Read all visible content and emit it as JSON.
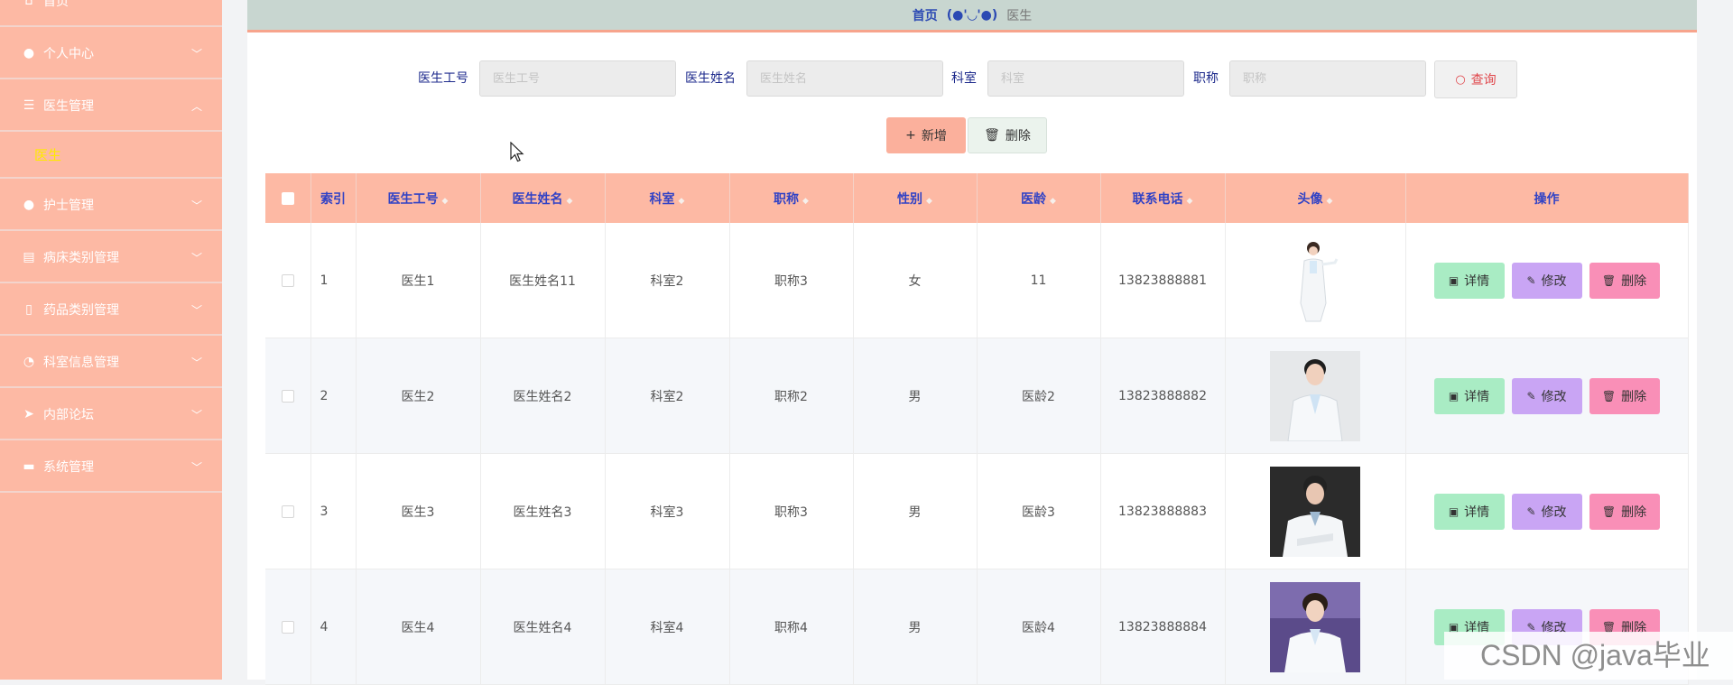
{
  "sidebar": {
    "items": [
      {
        "label": "首页",
        "icon": "home-icon",
        "caret": ""
      },
      {
        "label": "个人中心",
        "icon": "user-icon",
        "caret": "﹀"
      },
      {
        "label": "医生管理",
        "icon": "list-icon",
        "caret": "︿"
      },
      {
        "label": "护士管理",
        "icon": "user-icon",
        "caret": "﹀"
      },
      {
        "label": "病床类别管理",
        "icon": "chat-icon",
        "caret": "﹀"
      },
      {
        "label": "药品类别管理",
        "icon": "mic-icon",
        "caret": "﹀"
      },
      {
        "label": "科室信息管理",
        "icon": "gauge-icon",
        "caret": "﹀"
      },
      {
        "label": "内部论坛",
        "icon": "send-icon",
        "caret": "﹀"
      },
      {
        "label": "系统管理",
        "icon": "briefcase-icon",
        "caret": "﹀"
      }
    ],
    "active_submenu": "医生"
  },
  "breadcrumb": {
    "home": "首页",
    "face": "(●'◡'●)",
    "current": "医生"
  },
  "search": {
    "fields": [
      {
        "label": "医生工号",
        "placeholder": "医生工号",
        "value": ""
      },
      {
        "label": "医生姓名",
        "placeholder": "医生姓名",
        "value": ""
      },
      {
        "label": "科室",
        "placeholder": "科室",
        "value": ""
      },
      {
        "label": "职称",
        "placeholder": "职称",
        "value": ""
      }
    ],
    "query_label": "查询"
  },
  "actions": {
    "add_label": "新增",
    "delete_label": "删除"
  },
  "table": {
    "columns": [
      "索引",
      "医生工号",
      "医生姓名",
      "科室",
      "职称",
      "性别",
      "医龄",
      "联系电话",
      "头像",
      "操作"
    ],
    "rows": [
      {
        "index": "1",
        "id": "医生1",
        "name": "医生姓名11",
        "dept": "科室2",
        "title": "职称3",
        "gender": "女",
        "years": "11",
        "phone": "13823888881"
      },
      {
        "index": "2",
        "id": "医生2",
        "name": "医生姓名2",
        "dept": "科室2",
        "title": "职称2",
        "gender": "男",
        "years": "医龄2",
        "phone": "13823888882"
      },
      {
        "index": "3",
        "id": "医生3",
        "name": "医生姓名3",
        "dept": "科室3",
        "title": "职称3",
        "gender": "男",
        "years": "医龄3",
        "phone": "13823888883"
      },
      {
        "index": "4",
        "id": "医生4",
        "name": "医生姓名4",
        "dept": "科室4",
        "title": "职称4",
        "gender": "男",
        "years": "医龄4",
        "phone": "13823888884"
      }
    ],
    "row_actions": {
      "detail": "详情",
      "edit": "修改",
      "delete": "删除"
    }
  },
  "watermark": "CSDN @java毕业",
  "colors": {
    "sidebar_bg": "#fdb9a4",
    "header_bg": "#fdb9a4",
    "header_text": "#3142c5",
    "submenu_active": "#ffea00",
    "detail_btn": "#a9ecc4",
    "edit_btn": "#c9a5f4",
    "delete_btn": "#f98fb7",
    "add_btn": "#fbb09c"
  }
}
